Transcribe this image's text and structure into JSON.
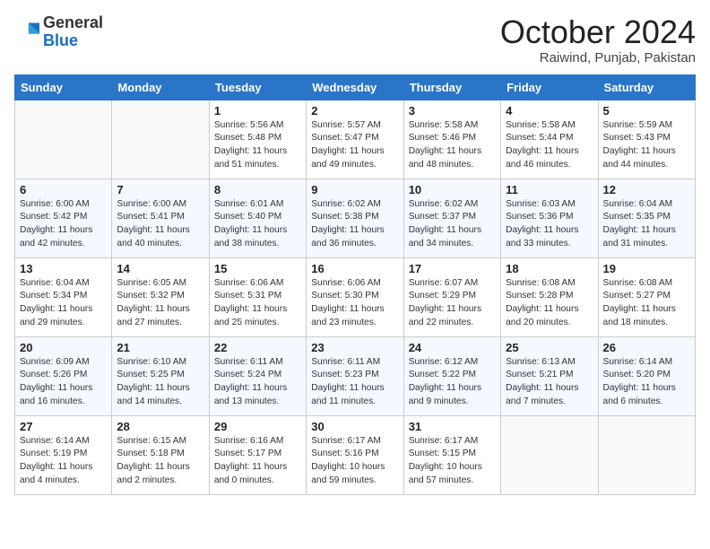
{
  "header": {
    "logo_general": "General",
    "logo_blue": "Blue",
    "month_title": "October 2024",
    "location": "Raiwind, Punjab, Pakistan"
  },
  "days_of_week": [
    "Sunday",
    "Monday",
    "Tuesday",
    "Wednesday",
    "Thursday",
    "Friday",
    "Saturday"
  ],
  "weeks": [
    [
      {
        "day": "",
        "content": ""
      },
      {
        "day": "",
        "content": ""
      },
      {
        "day": "1",
        "content": "Sunrise: 5:56 AM\nSunset: 5:48 PM\nDaylight: 11 hours and 51 minutes."
      },
      {
        "day": "2",
        "content": "Sunrise: 5:57 AM\nSunset: 5:47 PM\nDaylight: 11 hours and 49 minutes."
      },
      {
        "day": "3",
        "content": "Sunrise: 5:58 AM\nSunset: 5:46 PM\nDaylight: 11 hours and 48 minutes."
      },
      {
        "day": "4",
        "content": "Sunrise: 5:58 AM\nSunset: 5:44 PM\nDaylight: 11 hours and 46 minutes."
      },
      {
        "day": "5",
        "content": "Sunrise: 5:59 AM\nSunset: 5:43 PM\nDaylight: 11 hours and 44 minutes."
      }
    ],
    [
      {
        "day": "6",
        "content": "Sunrise: 6:00 AM\nSunset: 5:42 PM\nDaylight: 11 hours and 42 minutes."
      },
      {
        "day": "7",
        "content": "Sunrise: 6:00 AM\nSunset: 5:41 PM\nDaylight: 11 hours and 40 minutes."
      },
      {
        "day": "8",
        "content": "Sunrise: 6:01 AM\nSunset: 5:40 PM\nDaylight: 11 hours and 38 minutes."
      },
      {
        "day": "9",
        "content": "Sunrise: 6:02 AM\nSunset: 5:38 PM\nDaylight: 11 hours and 36 minutes."
      },
      {
        "day": "10",
        "content": "Sunrise: 6:02 AM\nSunset: 5:37 PM\nDaylight: 11 hours and 34 minutes."
      },
      {
        "day": "11",
        "content": "Sunrise: 6:03 AM\nSunset: 5:36 PM\nDaylight: 11 hours and 33 minutes."
      },
      {
        "day": "12",
        "content": "Sunrise: 6:04 AM\nSunset: 5:35 PM\nDaylight: 11 hours and 31 minutes."
      }
    ],
    [
      {
        "day": "13",
        "content": "Sunrise: 6:04 AM\nSunset: 5:34 PM\nDaylight: 11 hours and 29 minutes."
      },
      {
        "day": "14",
        "content": "Sunrise: 6:05 AM\nSunset: 5:32 PM\nDaylight: 11 hours and 27 minutes."
      },
      {
        "day": "15",
        "content": "Sunrise: 6:06 AM\nSunset: 5:31 PM\nDaylight: 11 hours and 25 minutes."
      },
      {
        "day": "16",
        "content": "Sunrise: 6:06 AM\nSunset: 5:30 PM\nDaylight: 11 hours and 23 minutes."
      },
      {
        "day": "17",
        "content": "Sunrise: 6:07 AM\nSunset: 5:29 PM\nDaylight: 11 hours and 22 minutes."
      },
      {
        "day": "18",
        "content": "Sunrise: 6:08 AM\nSunset: 5:28 PM\nDaylight: 11 hours and 20 minutes."
      },
      {
        "day": "19",
        "content": "Sunrise: 6:08 AM\nSunset: 5:27 PM\nDaylight: 11 hours and 18 minutes."
      }
    ],
    [
      {
        "day": "20",
        "content": "Sunrise: 6:09 AM\nSunset: 5:26 PM\nDaylight: 11 hours and 16 minutes."
      },
      {
        "day": "21",
        "content": "Sunrise: 6:10 AM\nSunset: 5:25 PM\nDaylight: 11 hours and 14 minutes."
      },
      {
        "day": "22",
        "content": "Sunrise: 6:11 AM\nSunset: 5:24 PM\nDaylight: 11 hours and 13 minutes."
      },
      {
        "day": "23",
        "content": "Sunrise: 6:11 AM\nSunset: 5:23 PM\nDaylight: 11 hours and 11 minutes."
      },
      {
        "day": "24",
        "content": "Sunrise: 6:12 AM\nSunset: 5:22 PM\nDaylight: 11 hours and 9 minutes."
      },
      {
        "day": "25",
        "content": "Sunrise: 6:13 AM\nSunset: 5:21 PM\nDaylight: 11 hours and 7 minutes."
      },
      {
        "day": "26",
        "content": "Sunrise: 6:14 AM\nSunset: 5:20 PM\nDaylight: 11 hours and 6 minutes."
      }
    ],
    [
      {
        "day": "27",
        "content": "Sunrise: 6:14 AM\nSunset: 5:19 PM\nDaylight: 11 hours and 4 minutes."
      },
      {
        "day": "28",
        "content": "Sunrise: 6:15 AM\nSunset: 5:18 PM\nDaylight: 11 hours and 2 minutes."
      },
      {
        "day": "29",
        "content": "Sunrise: 6:16 AM\nSunset: 5:17 PM\nDaylight: 11 hours and 0 minutes."
      },
      {
        "day": "30",
        "content": "Sunrise: 6:17 AM\nSunset: 5:16 PM\nDaylight: 10 hours and 59 minutes."
      },
      {
        "day": "31",
        "content": "Sunrise: 6:17 AM\nSunset: 5:15 PM\nDaylight: 10 hours and 57 minutes."
      },
      {
        "day": "",
        "content": ""
      },
      {
        "day": "",
        "content": ""
      }
    ]
  ]
}
